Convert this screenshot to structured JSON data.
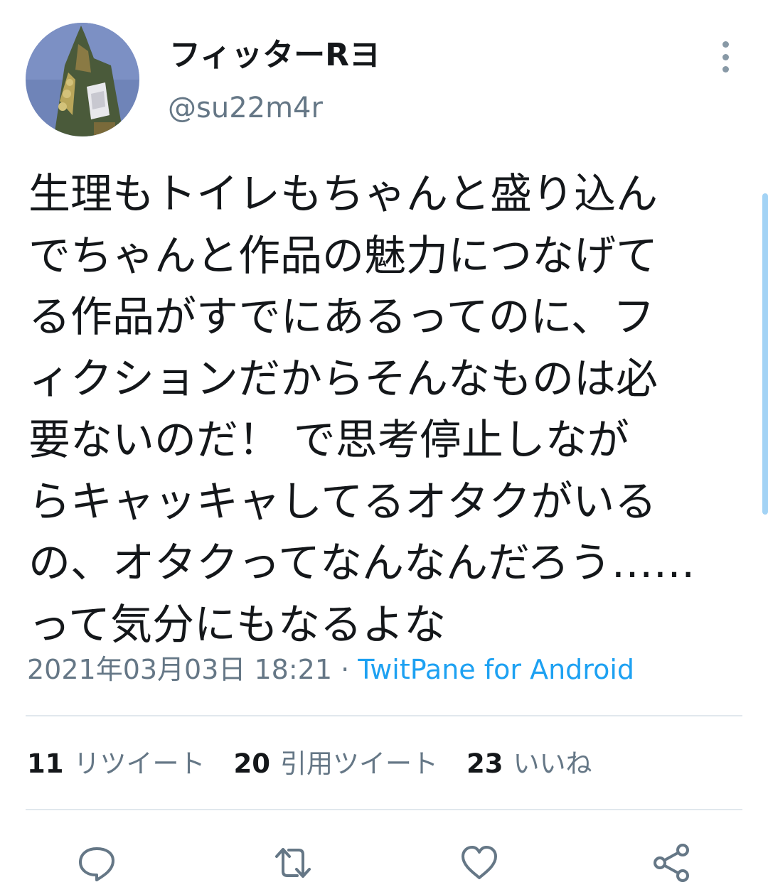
{
  "author": {
    "display_name": "フィッターRヨ",
    "handle": "@su22m4r",
    "avatar_icon": "robot-avatar-icon"
  },
  "menu": {
    "icon": "more-vertical-icon"
  },
  "tweet": {
    "text": "生理もトイレもちゃんと盛り込ん\nでちゃんと作品の魅力につなげて\nる作品がすでにあるってのに、フ\nィクションだからそんなものは必\n要ないのだ！ で思考停止しなが\nらキャッキャしてるオタクがいる\nの、オタクってなんなんだろう……\nって気分にもなるよな",
    "timestamp": "2021年03月03日 18:21",
    "separator": " · ",
    "source": "TwitPane for Android"
  },
  "stats": {
    "retweets_count": "11",
    "retweets_label": "リツイート",
    "quotes_count": "20",
    "quotes_label": "引用ツイート",
    "likes_count": "23",
    "likes_label": "いいね"
  },
  "actions": {
    "reply_icon": "reply-icon",
    "retweet_icon": "retweet-icon",
    "like_icon": "heart-icon",
    "share_icon": "share-icon"
  },
  "colors": {
    "text": "#14171a",
    "secondary": "#657786",
    "link": "#1da1f2",
    "divider": "#e1e8ed",
    "icon": "#657786"
  }
}
